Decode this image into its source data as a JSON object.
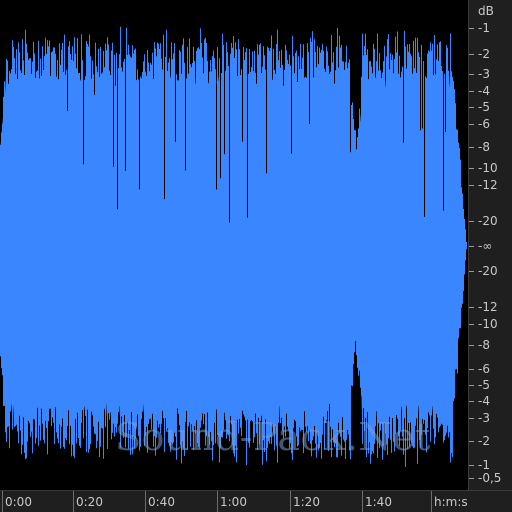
{
  "waveform": {
    "fill_color_top": "#3a86ff",
    "fill_color_bottom": "#3a7ee6",
    "background": "#000000",
    "watermark": "Sound-Pack.Net"
  },
  "db_scale": {
    "unit_label": "dB",
    "labels_top": [
      "-1",
      "-2",
      "-3",
      "-4",
      "-5",
      "-6",
      "-8",
      "-10",
      "-12",
      "-20"
    ],
    "center_label": "-∞",
    "labels_bottom": [
      "-20",
      "-12",
      "-10",
      "-8",
      "-6",
      "-5",
      "-4",
      "-3",
      "-2",
      "-1",
      "-0,5"
    ]
  },
  "time_axis": {
    "labels": [
      "0:00",
      "0:20",
      "0:40",
      "1:00",
      "1:20",
      "1:40"
    ],
    "unit_label": "h:m:s"
  }
}
